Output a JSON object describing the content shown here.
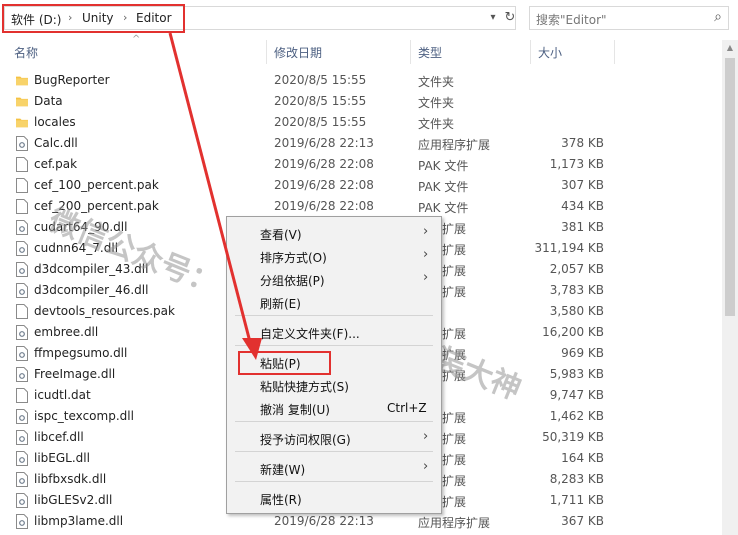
{
  "address": {
    "crumbs": [
      "软件 (D:)",
      "Unity",
      "Editor"
    ],
    "search_placeholder": "搜索\"Editor\""
  },
  "columns": {
    "name": "名称",
    "date": "修改日期",
    "type": "类型",
    "size": "大小"
  },
  "files": [
    {
      "name": "BugReporter",
      "date": "2020/8/5 15:55",
      "type": "文件夹",
      "size": "",
      "icon": "folder-icon"
    },
    {
      "name": "Data",
      "date": "2020/8/5 15:55",
      "type": "文件夹",
      "size": "",
      "icon": "folder-icon"
    },
    {
      "name": "locales",
      "date": "2020/8/5 15:55",
      "type": "文件夹",
      "size": "",
      "icon": "folder-icon"
    },
    {
      "name": "Calc.dll",
      "date": "2019/6/28 22:13",
      "type": "应用程序扩展",
      "size": "378 KB",
      "icon": "dll-file-icon"
    },
    {
      "name": "cef.pak",
      "date": "2019/6/28 22:08",
      "type": "PAK 文件",
      "size": "1,173 KB",
      "icon": "file-icon"
    },
    {
      "name": "cef_100_percent.pak",
      "date": "2019/6/28 22:08",
      "type": "PAK 文件",
      "size": "307 KB",
      "icon": "file-icon"
    },
    {
      "name": "cef_200_percent.pak",
      "date": "2019/6/28 22:08",
      "type": "PAK 文件",
      "size": "434 KB",
      "icon": "file-icon"
    },
    {
      "name": "cudart64_90.dll",
      "date": "",
      "type": "程序扩展",
      "size": "381 KB",
      "icon": "dll-file-icon"
    },
    {
      "name": "cudnn64_7.dll",
      "date": "",
      "type": "程序扩展",
      "size": "311,194 KB",
      "icon": "dll-file-icon"
    },
    {
      "name": "d3dcompiler_43.dll",
      "date": "",
      "type": "程序扩展",
      "size": "2,057 KB",
      "icon": "dll-file-icon"
    },
    {
      "name": "d3dcompiler_46.dll",
      "date": "",
      "type": "程序扩展",
      "size": "3,783 KB",
      "icon": "dll-file-icon"
    },
    {
      "name": "devtools_resources.pak",
      "date": "",
      "type": "文件",
      "size": "3,580 KB",
      "icon": "file-icon"
    },
    {
      "name": "embree.dll",
      "date": "",
      "type": "程序扩展",
      "size": "16,200 KB",
      "icon": "dll-file-icon"
    },
    {
      "name": "ffmpegsumo.dll",
      "date": "",
      "type": "程序扩展",
      "size": "969 KB",
      "icon": "dll-file-icon"
    },
    {
      "name": "FreeImage.dll",
      "date": "",
      "type": "程序扩展",
      "size": "5,983 KB",
      "icon": "dll-file-icon"
    },
    {
      "name": "icudtl.dat",
      "date": "",
      "type": "文件",
      "size": "9,747 KB",
      "icon": "file-icon"
    },
    {
      "name": "ispc_texcomp.dll",
      "date": "",
      "type": "程序扩展",
      "size": "1,462 KB",
      "icon": "dll-file-icon"
    },
    {
      "name": "libcef.dll",
      "date": "",
      "type": "程序扩展",
      "size": "50,319 KB",
      "icon": "dll-file-icon"
    },
    {
      "name": "libEGL.dll",
      "date": "",
      "type": "程序扩展",
      "size": "164 KB",
      "icon": "dll-file-icon"
    },
    {
      "name": "libfbxsdk.dll",
      "date": "",
      "type": "程序扩展",
      "size": "8,283 KB",
      "icon": "dll-file-icon"
    },
    {
      "name": "libGLESv2.dll",
      "date": "",
      "type": "程序扩展",
      "size": "1,711 KB",
      "icon": "dll-file-icon"
    },
    {
      "name": "libmp3lame.dll",
      "date": "2019/6/28 22:13",
      "type": "应用程序扩展",
      "size": "367 KB",
      "icon": "dll-file-icon"
    }
  ],
  "context_menu": {
    "items": [
      {
        "label": "查看(V)",
        "shortcut": "",
        "submenu": true
      },
      {
        "label": "排序方式(O)",
        "shortcut": "",
        "submenu": true
      },
      {
        "label": "分组依据(P)",
        "shortcut": "",
        "submenu": true
      },
      {
        "label": "刷新(E)",
        "shortcut": "",
        "submenu": false
      },
      {
        "label": "自定义文件夹(F)...",
        "shortcut": "",
        "submenu": false
      },
      {
        "label": "粘贴(P)",
        "shortcut": "",
        "submenu": false
      },
      {
        "label": "粘贴快捷方式(S)",
        "shortcut": "",
        "submenu": false
      },
      {
        "label": "撤消 复制(U)",
        "shortcut": "Ctrl+Z",
        "submenu": false
      },
      {
        "label": "授予访问权限(G)",
        "shortcut": "",
        "submenu": true
      },
      {
        "label": "新建(W)",
        "shortcut": "",
        "submenu": true
      },
      {
        "label": "属性(R)",
        "shortcut": "",
        "submenu": false
      }
    ]
  },
  "watermark": {
    "line1": "微信公众号：",
    "line2": "软件安装大神"
  },
  "colors": {
    "highlight": "#e2312f",
    "folder": "#f5c242",
    "header_text": "#4d6082"
  }
}
